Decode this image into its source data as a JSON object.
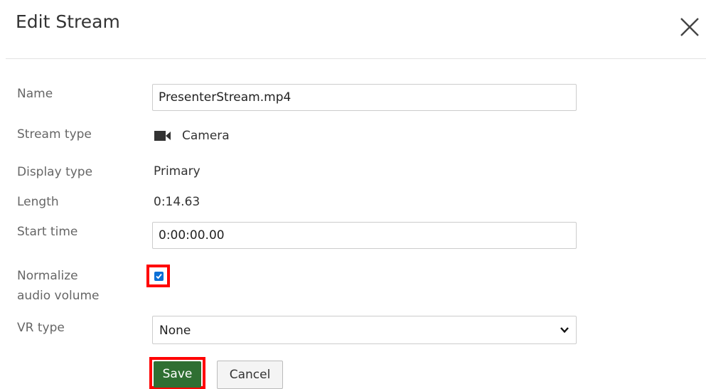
{
  "dialog": {
    "title": "Edit Stream",
    "close_icon": "close-icon"
  },
  "fields": {
    "name": {
      "label": "Name",
      "value": "PresenterStream.mp4"
    },
    "stream_type": {
      "label": "Stream type",
      "value": "Camera",
      "icon": "video-camera-icon"
    },
    "display_type": {
      "label": "Display type",
      "value": "Primary"
    },
    "length": {
      "label": "Length",
      "value": "0:14.63"
    },
    "start_time": {
      "label": "Start time",
      "value": "0:00:00.00"
    },
    "normalize_audio": {
      "label_line1": "Normalize",
      "label_line2": "audio volume",
      "checked": true
    },
    "vr_type": {
      "label": "VR type",
      "selected": "None"
    }
  },
  "actions": {
    "save_label": "Save",
    "cancel_label": "Cancel"
  },
  "colors": {
    "save_bg": "#2f6f32",
    "highlight": "#ff0000",
    "checkbox_accent": "#0a6fd6"
  }
}
